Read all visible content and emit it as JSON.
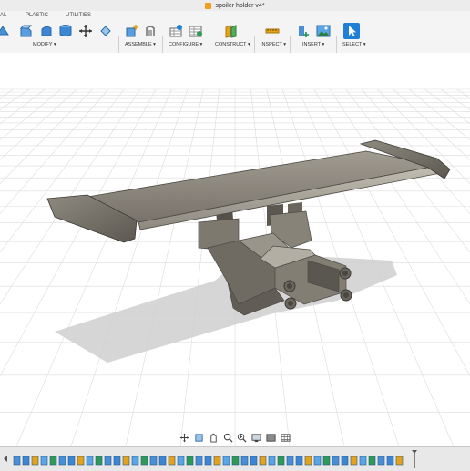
{
  "window": {
    "title": "spoiler holder v4*"
  },
  "tabs": [
    {
      "label": "AL"
    },
    {
      "label": "PLASTIC"
    },
    {
      "label": "UTILITIES"
    }
  ],
  "toolbar_groups": [
    {
      "label": "MODIFY ▾",
      "name": "modify"
    },
    {
      "label": "ASSEMBLE ▾",
      "name": "assemble"
    },
    {
      "label": "CONFIGURE ▾",
      "name": "configure"
    },
    {
      "label": "CONSTRUCT ▾",
      "name": "construct"
    },
    {
      "label": "INSPECT ▾",
      "name": "inspect"
    },
    {
      "label": "INSERT ▾",
      "name": "insert"
    },
    {
      "label": "SELECT ▾",
      "name": "select"
    }
  ],
  "icons": {
    "modify": [
      "press-pull-icon",
      "fillet-icon",
      "shell-icon",
      "move-icon",
      "sketch-scale-icon"
    ],
    "assemble": [
      "new-component-icon",
      "joint-icon"
    ],
    "configure": [
      "configure-table-icon",
      "configure-rule-icon"
    ],
    "construct": [
      "offset-plane-icon"
    ],
    "inspect": [
      "measure-icon"
    ],
    "insert": [
      "insert-derive-icon",
      "insert-image-icon"
    ],
    "select": [
      "select-arrow-icon"
    ]
  },
  "nav_bar": [
    "orbit-icon",
    "look-at-icon",
    "pan-icon",
    "zoom-icon",
    "fit-icon",
    "display-settings-icon",
    "visual-style-icon",
    "grid-icon"
  ],
  "timeline": {
    "feature_count": 43
  },
  "colors": {
    "accent": "#1e7fd4",
    "model": "#8f8a80",
    "model_dark": "#5c5851",
    "shadow": "#cfcfcf",
    "grid": "#dcdcdc"
  }
}
